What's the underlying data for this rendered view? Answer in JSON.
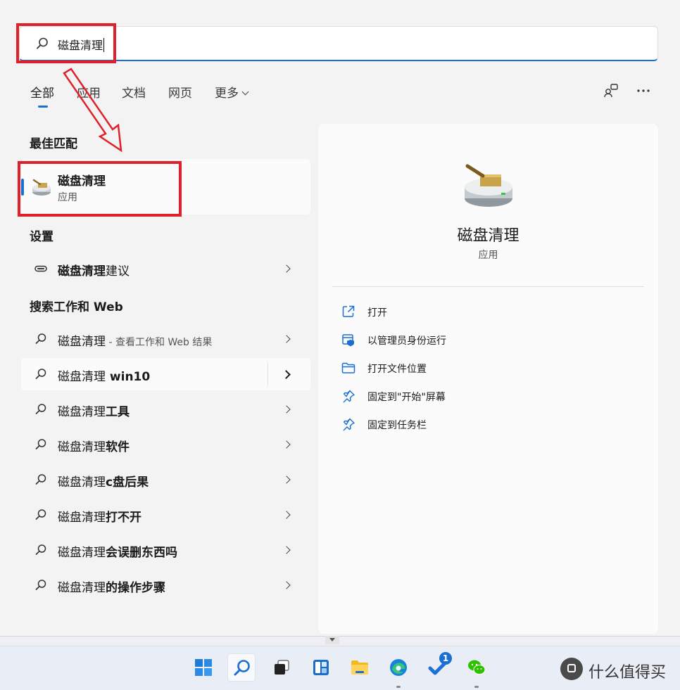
{
  "search": {
    "query": "磁盘清理"
  },
  "tabs": [
    {
      "label": "全部",
      "active": true
    },
    {
      "label": "应用"
    },
    {
      "label": "文档"
    },
    {
      "label": "网页"
    },
    {
      "label": "更多"
    }
  ],
  "top_icons": [
    "share-feedback-icon",
    "more-options-icon"
  ],
  "best_match": {
    "section_title": "最佳匹配",
    "name": "磁盘清理",
    "type": "应用",
    "icon": "disk-cleanup-icon"
  },
  "settings": {
    "section_title": "设置",
    "item": {
      "text_plain": "磁盘清理",
      "text_rest": "建议"
    }
  },
  "web": {
    "section_title": "搜索工作和 Web",
    "items": [
      {
        "prefix": "磁盘清理",
        "rest": "",
        "hint": " - 查看工作和 Web 结果"
      },
      {
        "prefix": "磁盘清理",
        "rest": " win10",
        "hint": ""
      },
      {
        "prefix": "磁盘清理",
        "rest": "工具",
        "hint": ""
      },
      {
        "prefix": "磁盘清理",
        "rest": "软件",
        "hint": ""
      },
      {
        "prefix": "磁盘清理",
        "rest": "c盘后果",
        "hint": ""
      },
      {
        "prefix": "磁盘清理",
        "rest": "打不开",
        "hint": ""
      },
      {
        "prefix": "磁盘清理",
        "rest": "会误删东西吗",
        "hint": ""
      },
      {
        "prefix": "磁盘清理",
        "rest": "的操作步骤",
        "hint": ""
      }
    ]
  },
  "preview": {
    "title": "磁盘清理",
    "subtitle": "应用",
    "actions": [
      {
        "label": "打开",
        "icon": "open-icon"
      },
      {
        "label": "以管理员身份运行",
        "icon": "run-as-admin-icon"
      },
      {
        "label": "打开文件位置",
        "icon": "folder-icon"
      },
      {
        "label": "固定到\"开始\"屏幕",
        "icon": "pin-icon"
      },
      {
        "label": "固定到任务栏",
        "icon": "pin-icon"
      }
    ]
  },
  "taskbar": {
    "apps": [
      "windows-start-icon",
      "search-icon",
      "task-view-icon",
      "widgets-icon",
      "file-explorer-icon",
      "edge-icon",
      "todo-icon",
      "wechat-icon"
    ],
    "todo_badge": "1"
  },
  "watermark": "什么值得买",
  "colors": {
    "accent": "#1a6fd1",
    "annotation_red": "#e0212b"
  }
}
